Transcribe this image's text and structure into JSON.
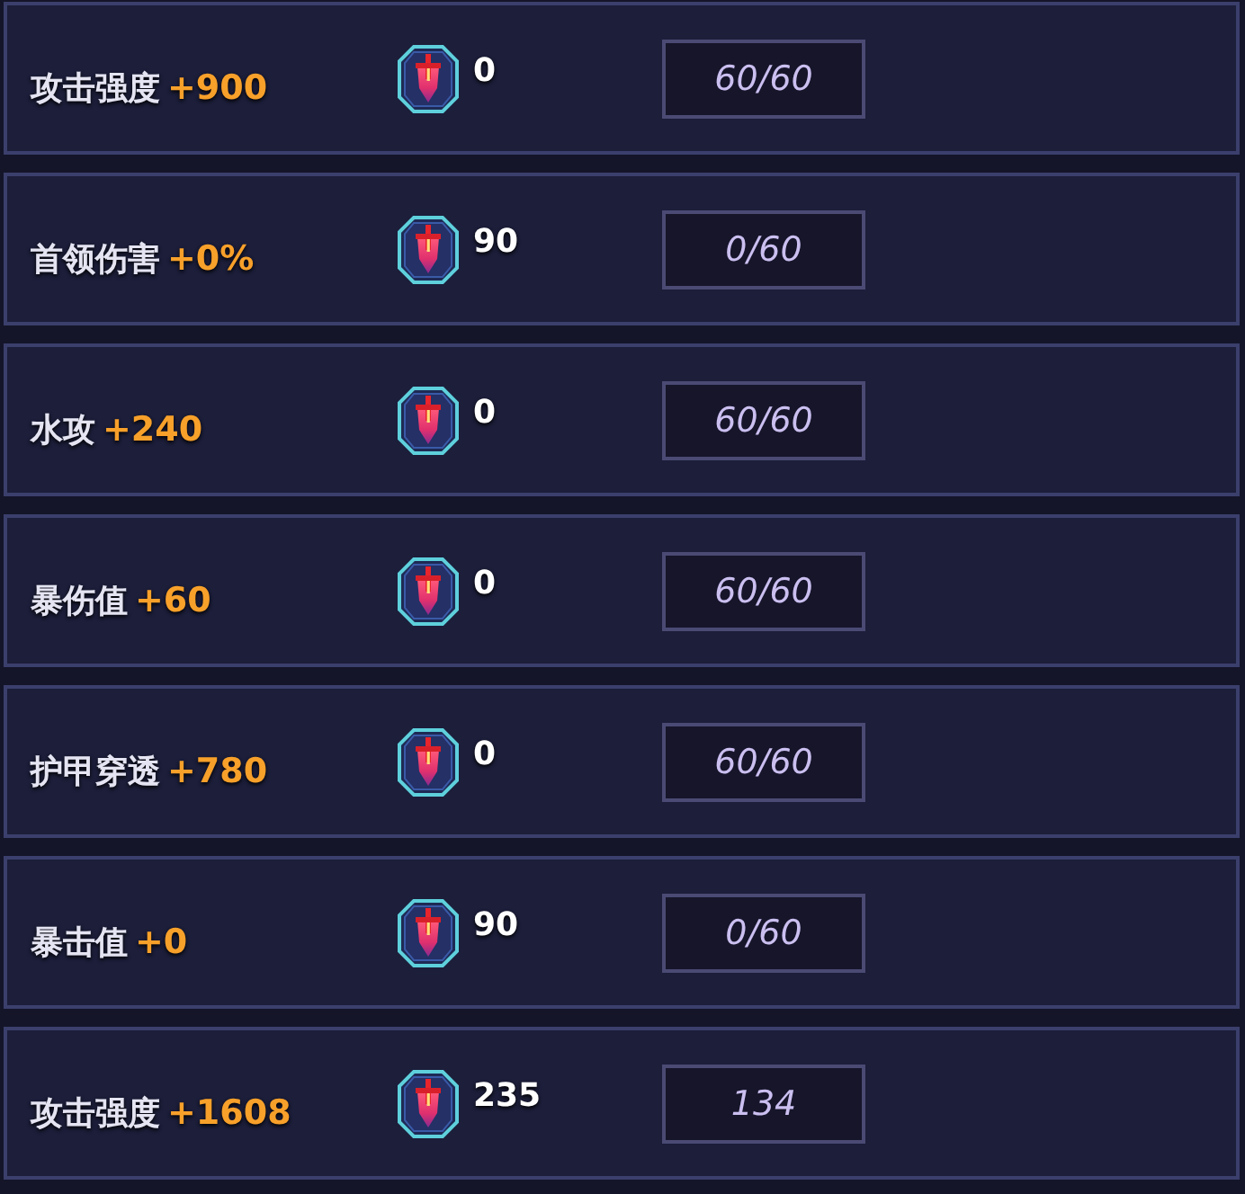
{
  "rows": [
    {
      "stat": "攻击强度",
      "bonus": "+900",
      "count": "0",
      "value": "60/60"
    },
    {
      "stat": "首领伤害",
      "bonus": "+0%",
      "count": "90",
      "value": "0/60"
    },
    {
      "stat": "水攻",
      "bonus": "+240",
      "count": "0",
      "value": "60/60"
    },
    {
      "stat": "暴伤值",
      "bonus": "+60",
      "count": "0",
      "value": "60/60"
    },
    {
      "stat": "护甲穿透",
      "bonus": "+780",
      "count": "0",
      "value": "60/60"
    },
    {
      "stat": "暴击值",
      "bonus": "+0",
      "count": "90",
      "value": "0/60"
    },
    {
      "stat": "攻击强度",
      "bonus": "+1608",
      "count": "235",
      "value": "134"
    }
  ]
}
